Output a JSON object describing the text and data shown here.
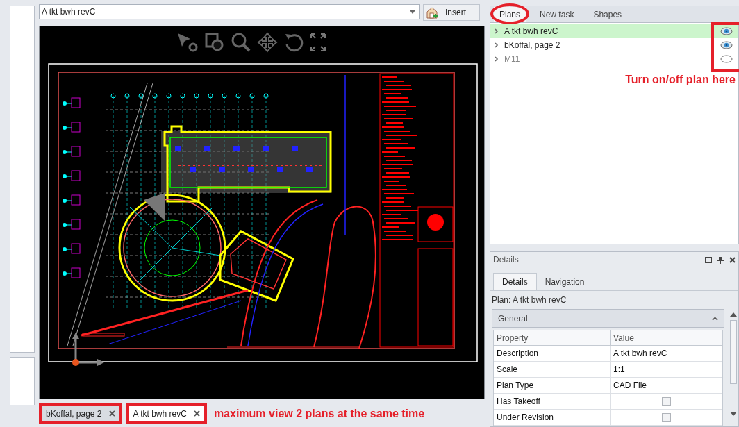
{
  "plan_selector": {
    "value": "A tkt bwh revC",
    "insert_button": "Insert"
  },
  "document_tabs": [
    {
      "label": "bKoffal, page 2",
      "selected": false
    },
    {
      "label": "A tkt bwh revC",
      "selected": true
    }
  ],
  "plans_panel": {
    "tabs": [
      {
        "label": "Plans",
        "selected": true
      },
      {
        "label": "New task",
        "selected": false
      },
      {
        "label": "Shapes",
        "selected": false
      }
    ],
    "plans": [
      {
        "name": "A tkt bwh revC",
        "selected": true,
        "visible": true
      },
      {
        "name": "bKoffal, page 2",
        "selected": false,
        "visible": true
      },
      {
        "name": "M11",
        "selected": false,
        "visible": false
      }
    ]
  },
  "details_panel": {
    "title": "Details",
    "tabs": [
      {
        "label": "Details",
        "selected": true
      },
      {
        "label": "Navigation",
        "selected": false
      }
    ],
    "plan_label": "Plan: A tkt bwh revC",
    "group": {
      "title": "General",
      "expanded": true
    },
    "columns": [
      "Property",
      "Value"
    ],
    "rows": [
      {
        "property": "Description",
        "kind": "text",
        "value": "A tkt bwh revC"
      },
      {
        "property": "Scale",
        "kind": "text",
        "value": "1:1"
      },
      {
        "property": "Plan Type",
        "kind": "text",
        "value": "CAD File"
      },
      {
        "property": "Has Takeoff",
        "kind": "checkbox",
        "checked": false
      },
      {
        "property": "Under Revision",
        "kind": "checkbox",
        "checked": false
      }
    ]
  },
  "annotations": [
    {
      "kind": "plans-note",
      "text": "Turn on/off plan here"
    },
    {
      "kind": "tabs-note",
      "text": "maximum view 2 plans at the same time"
    }
  ]
}
